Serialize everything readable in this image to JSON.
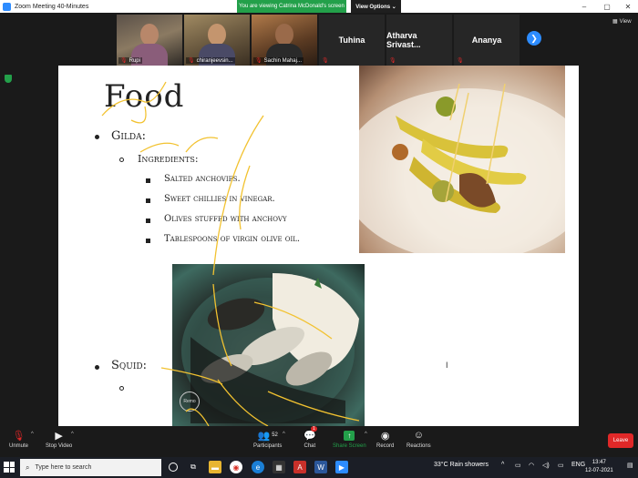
{
  "window": {
    "title": "Zoom Meeting 40-Minutes",
    "viewing_banner": "You are viewing Catrina McDonald's screen",
    "view_options": "View Options ⌄",
    "view_label": "View"
  },
  "participants": [
    {
      "name": "Rupi",
      "has_video": true
    },
    {
      "name": "chiranjeevsin...",
      "has_video": true
    },
    {
      "name": "Sachin Mahaj...",
      "has_video": true
    },
    {
      "name": "Tuhina",
      "has_video": false
    },
    {
      "name": "Atharva Srivast...",
      "has_video": false
    },
    {
      "name": "Ananya",
      "has_video": false
    }
  ],
  "slide": {
    "title": "Food",
    "items": [
      {
        "level": 1,
        "text": "Gilda:"
      },
      {
        "level": 2,
        "text": "Ingredients:"
      },
      {
        "level": 3,
        "text": "Salted anchovies."
      },
      {
        "level": 3,
        "text": "Sweet chillies in vinegar."
      },
      {
        "level": 3,
        "text": "Olives stuffed with anchovy"
      },
      {
        "level": 3,
        "text": "Tablespoons of virgin olive oil."
      },
      {
        "level": 1,
        "text": "Squid:"
      },
      {
        "level": 2,
        "text": ""
      }
    ],
    "photo_watermark": "Remo"
  },
  "toolbar": {
    "unmute": "Unmute",
    "stop_video": "Stop Video",
    "participants": "Participants",
    "participants_count": "52",
    "chat": "Chat",
    "chat_badge": "1",
    "share_screen": "Share Screen",
    "record": "Record",
    "reactions": "Reactions",
    "leave": "Leave"
  },
  "taskbar": {
    "search_placeholder": "Type here to search",
    "weather": "33°C  Rain showers",
    "language": "ENG",
    "time": "13:47",
    "date": "12-07-2021"
  },
  "colors": {
    "zoom_blue": "#2d8cff",
    "banner_green": "#23a04a",
    "leave_red": "#e02828",
    "annotation_yellow": "#f2c230"
  }
}
